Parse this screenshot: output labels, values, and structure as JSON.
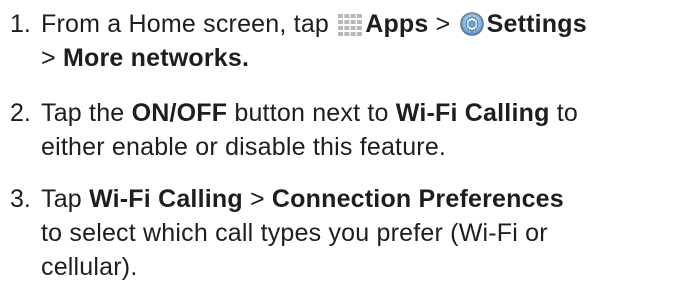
{
  "steps": [
    {
      "number": "1.",
      "line1_a": "From a Home screen, tap ",
      "apps_label": "Apps",
      "line1_b": " > ",
      "settings_label": "Settings",
      "line2_a": "> ",
      "more_networks": "More networks."
    },
    {
      "number": "2.",
      "line1_a": "Tap the ",
      "onoff": "ON/OFF",
      "line1_b": " button next to ",
      "wifi_calling": "Wi-Fi Calling",
      "line1_c": " to",
      "line2": "either enable or disable this feature."
    },
    {
      "number": "3.",
      "line1_a": "Tap ",
      "wifi_calling": "Wi-Fi Calling",
      "line1_b": " > ",
      "connection_prefs": "Connection Preferences",
      "line2": "to select which call types you prefer (Wi-Fi or",
      "line3": "cellular)."
    }
  ],
  "icons": {
    "apps": "apps-grid-icon",
    "settings": "settings-gear-icon"
  },
  "colors": {
    "text": "#1e1e1e",
    "apps_icon": "#b8b8b8",
    "settings_blue": "#3a7fc0"
  }
}
